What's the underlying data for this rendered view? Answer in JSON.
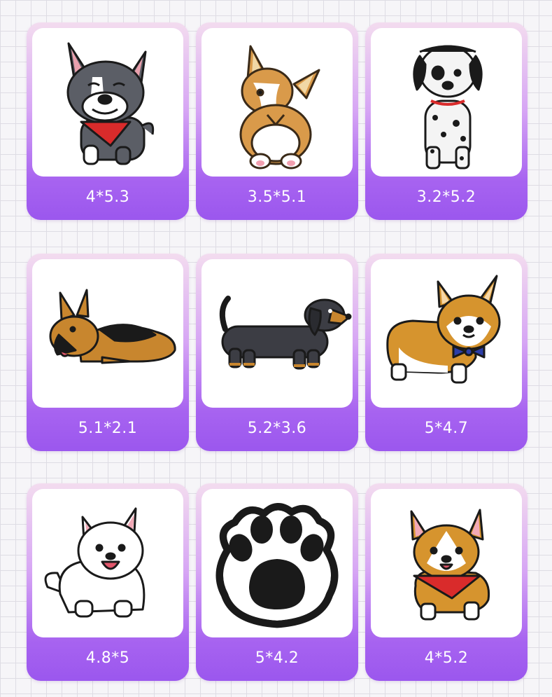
{
  "patches": [
    {
      "icon": "french-bulldog-patch-icon",
      "size_label": "4*5.3"
    },
    {
      "icon": "corgi-back-patch-icon",
      "size_label": "3.5*5.1"
    },
    {
      "icon": "dalmatian-patch-icon",
      "size_label": "3.2*5.2"
    },
    {
      "icon": "german-shepherd-patch-icon",
      "size_label": "5.1*2.1"
    },
    {
      "icon": "dachshund-patch-icon",
      "size_label": "5.2*3.6"
    },
    {
      "icon": "corgi-bowtie-patch-icon",
      "size_label": "5*4.7"
    },
    {
      "icon": "samoyed-patch-icon",
      "size_label": "4.8*5"
    },
    {
      "icon": "paw-print-patch-icon",
      "size_label": "5*4.2"
    },
    {
      "icon": "corgi-bandana-patch-icon",
      "size_label": "4*5.2"
    }
  ],
  "colors": {
    "card_gradient_top": "#f3dcef",
    "card_gradient_bottom": "#9b57ee",
    "label_text": "#ffffff",
    "background_grid": "#dedce4"
  }
}
